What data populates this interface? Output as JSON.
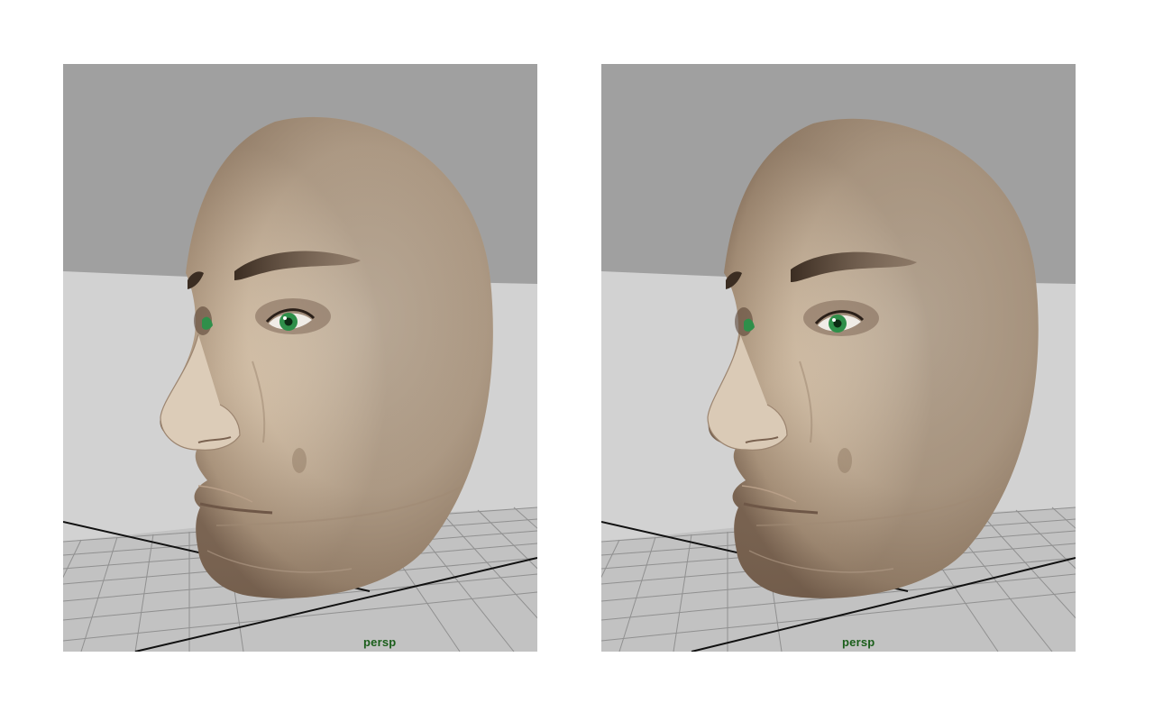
{
  "viewports": [
    {
      "camera_label": "persp"
    },
    {
      "camera_label": "persp"
    }
  ],
  "colors": {
    "background_upper": "#a0a0a0",
    "background_lower": "#d2d2d2",
    "grid_floor": "#bdbdbd",
    "grid_line": "#8f8f8f",
    "grid_axis": "#111111",
    "skin": "#d9c8b2",
    "skin_shadow": "#8c7560",
    "eyebrow": "#4a3a2c",
    "iris": "#2f8f4a",
    "camera_label": "#1a5e1a"
  }
}
